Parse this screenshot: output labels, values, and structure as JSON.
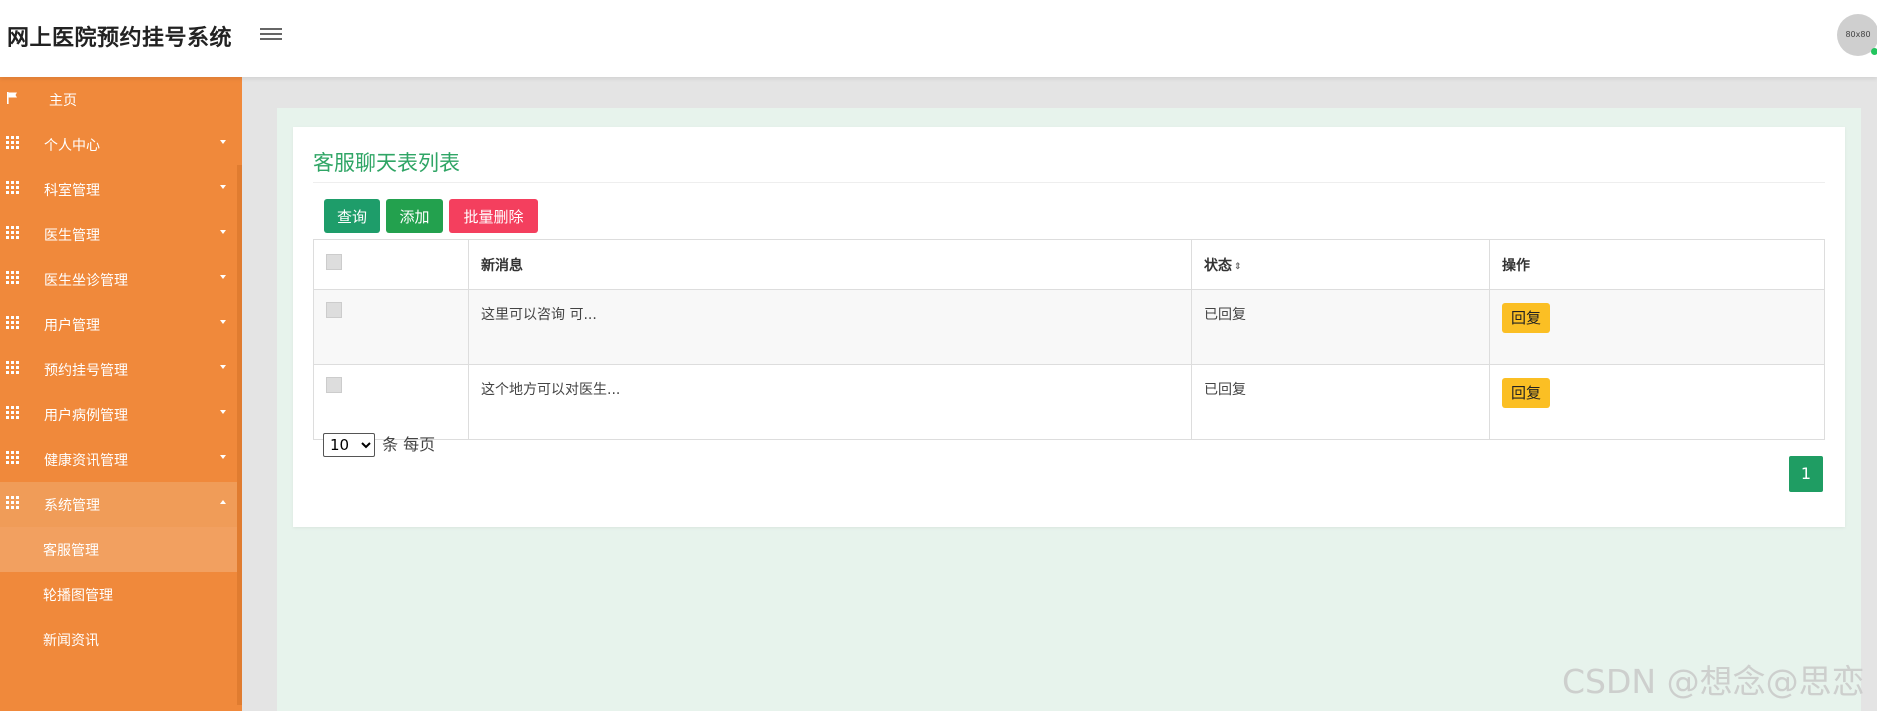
{
  "header": {
    "app_title": "网上医院预约挂号系统",
    "avatar_text": "80x80"
  },
  "sidebar": {
    "items": [
      {
        "label": "主页",
        "icon": "flag-icon"
      },
      {
        "label": "个人中心",
        "icon": "grid-icon"
      },
      {
        "label": "科室管理",
        "icon": "grid-icon"
      },
      {
        "label": "医生管理",
        "icon": "grid-icon"
      },
      {
        "label": "医生坐诊管理",
        "icon": "grid-icon"
      },
      {
        "label": "用户管理",
        "icon": "grid-icon"
      },
      {
        "label": "预约挂号管理",
        "icon": "grid-icon"
      },
      {
        "label": "用户病例管理",
        "icon": "grid-icon"
      },
      {
        "label": "健康资讯管理",
        "icon": "grid-icon"
      },
      {
        "label": "系统管理",
        "icon": "grid-icon"
      }
    ],
    "subitems": [
      {
        "label": "客服管理"
      },
      {
        "label": "轮播图管理"
      },
      {
        "label": "新闻资讯"
      }
    ]
  },
  "main": {
    "title": "客服聊天表列表",
    "buttons": {
      "query": "查询",
      "add": "添加",
      "batch_delete": "批量删除"
    },
    "table": {
      "headers": {
        "message": "新消息",
        "status": "状态",
        "action": "操作"
      },
      "rows": [
        {
          "message": "这里可以咨询 可...",
          "status": "已回复",
          "action": "回复"
        },
        {
          "message": "这个地方可以对医生...",
          "status": "已回复",
          "action": "回复"
        }
      ]
    },
    "pagination": {
      "page_size": "10",
      "suffix": "条 每页",
      "current_page": "1"
    }
  },
  "watermark": "CSDN @想念@思恋",
  "colors": {
    "sidebar": "#f0893b",
    "title_green": "#2fa565",
    "query_button": "#1e9d6a",
    "add_button": "#23a14e",
    "delete_button": "#f43f5e",
    "reply_button": "#fbbf24",
    "main_background": "#e7f3ec"
  }
}
